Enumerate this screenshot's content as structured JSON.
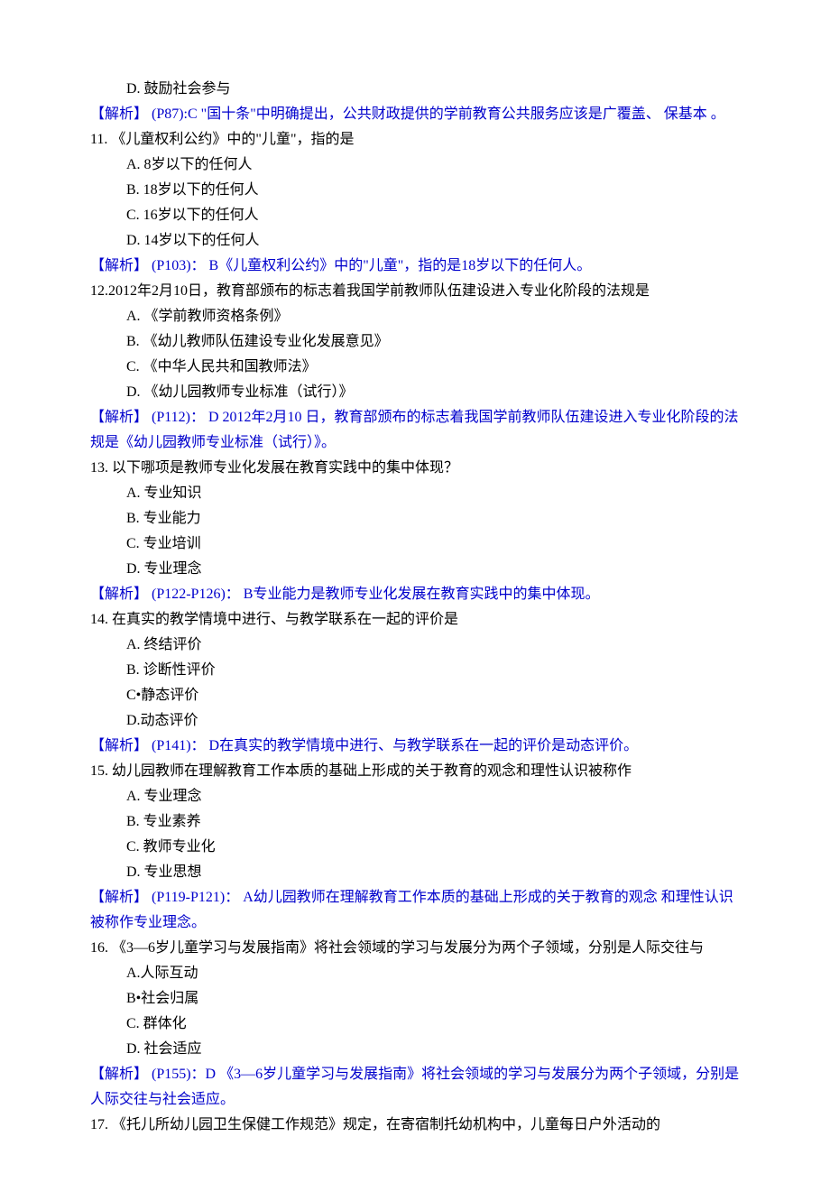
{
  "q10": {
    "optD": "D. 鼓励社会参与",
    "ans": "【解析】 (P87):C \"国十条\"中明确提出，公共财政提供的学前教育公共服务应该是广覆盖、 保基本 。"
  },
  "q11": {
    "stem": "11. 《儿童权利公约》中的\"儿童\"，指的是",
    "optA": "A. 8岁以下的任何人",
    "optB": "B. 18岁以下的任何人",
    "optC": "C. 16岁以下的任何人",
    "optD": "D. 14岁以下的任何人",
    "ans": "【解析】 (P103)： B《儿童权利公约》中的\"儿童\"，指的是18岁以下的任何人。"
  },
  "q12": {
    "stem": "12.2012年2月10日，教育部颁布的标志着我国学前教师队伍建设进入专业化阶段的法规是",
    "optA": "A.  《学前教师资格条例》",
    "optB": "B.  《幼儿教师队伍建设专业化发展意见》",
    "optC": "C.  《中华人民共和国教师法》",
    "optD": "D.  《幼儿园教师专业标准（试行）》",
    "ans": "【解析】 (P112)： D 2012年2月10 日，教育部颁布的标志着我国学前教师队伍建设进入专业化阶段的法规是《幼儿园教师专业标准（试行）》。"
  },
  "q13": {
    "stem": "13. 以下哪项是教师专业化发展在教育实践中的集中体现？",
    "optA": "A. 专业知识",
    "optB": "B. 专业能力",
    "optC": "C. 专业培训",
    "optD": "D. 专业理念",
    "ans": "【解析】 (P122-P126)： B专业能力是教师专业化发展在教育实践中的集中体现。"
  },
  "q14": {
    "stem": "14. 在真实的教学情境中进行、与教学联系在一起的评价是",
    "optA": "A. 终结评价",
    "optB": "B. 诊断性评价",
    "optC": "C•静态评价",
    "optD": "D.动态评价",
    "ans": "【解析】 (P141)： D在真实的教学情境中进行、与教学联系在一起的评价是动态评价。"
  },
  "q15": {
    "stem": "15. 幼儿园教师在理解教育工作本质的基础上形成的关于教育的观念和理性认识被称作",
    "optA": "A. 专业理念",
    "optB": "B. 专业素养",
    "optC": "C. 教师专业化",
    "optD": "D. 专业思想",
    "ans": "【解析】 (P119-P121)： A幼儿园教师在理解教育工作本质的基础上形成的关于教育的观念 和理性认识被称作专业理念。"
  },
  "q16": {
    "stem": "16.   《3—6岁儿童学习与发展指南》将社会领域的学习与发展分为两个子领域，分别是人际交往与",
    "optA": "A.人际互动",
    "optB": "B•社会归属",
    "optC": "C. 群体化",
    "optD": "D. 社会适应",
    "ans": "【解析】 (P155)：D 《3—6岁儿童学习与发展指南》将社会领域的学习与发展分为两个子领域，分别是人际交往与社会适应。"
  },
  "q17": {
    "stem": "17.   《托儿所幼儿园卫生保健工作规范》规定，在寄宿制托幼机构中，儿童每日户外活动的"
  }
}
